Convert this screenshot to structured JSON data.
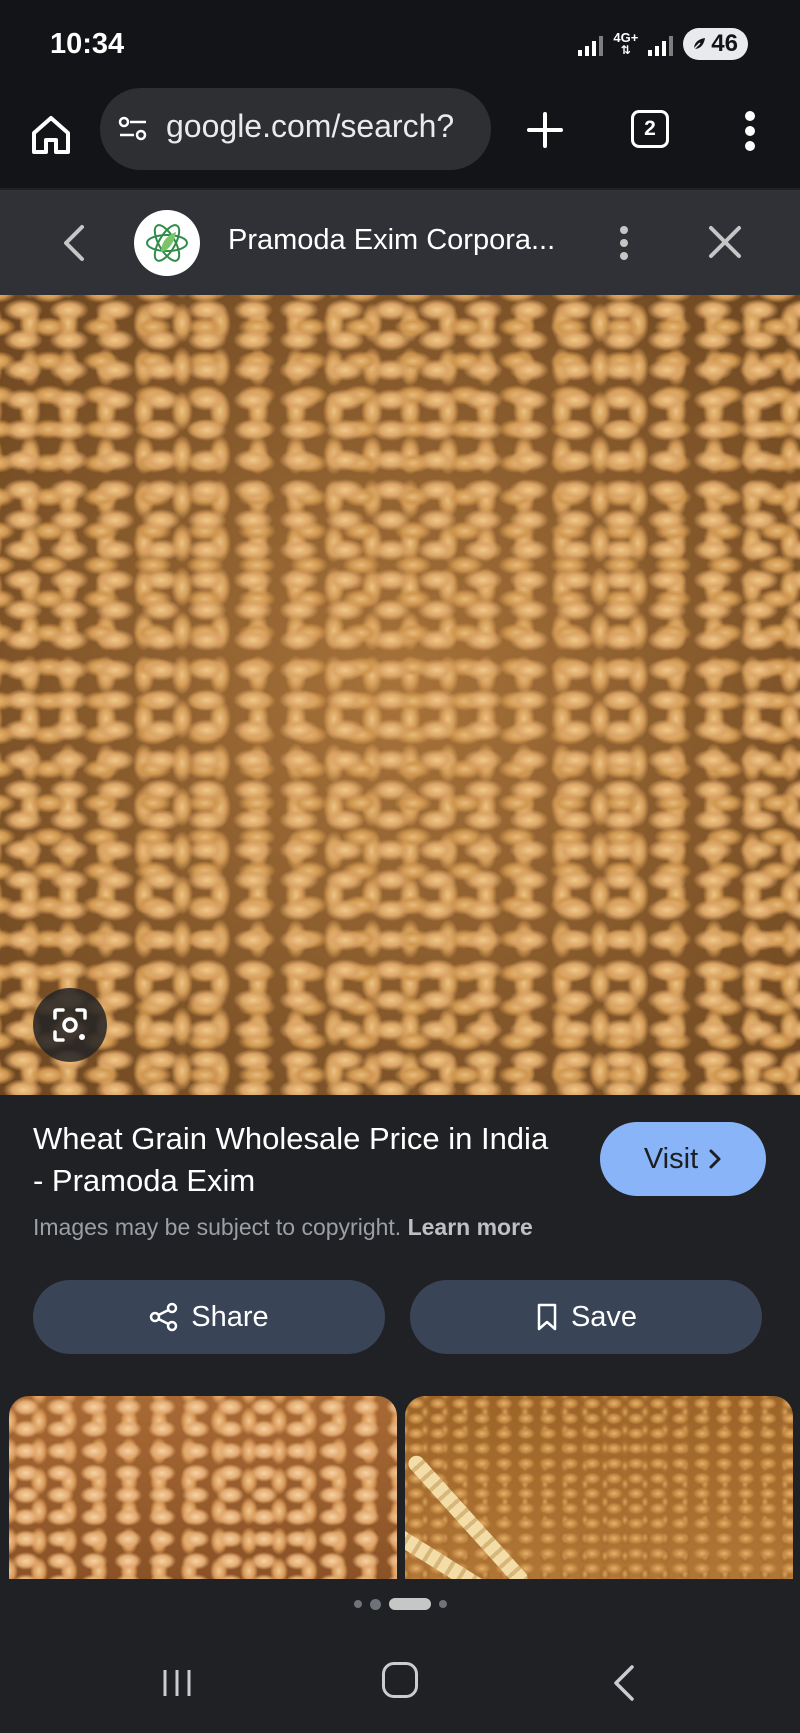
{
  "status_bar": {
    "time": "10:34",
    "network_label": "4G+",
    "battery_level": "46"
  },
  "browser": {
    "url": "google.com/search?",
    "tab_count": "2"
  },
  "source": {
    "site_name": "Pramoda Exim Corpora..."
  },
  "result": {
    "title": "Wheat Grain Wholesale Price in India - Pramoda Exim",
    "visit_label": "Visit",
    "copyright_text": "Images may be subject to copyright.",
    "learn_more_label": "Learn more",
    "share_label": "Share",
    "save_label": "Save"
  },
  "pager": {
    "pages": 4,
    "active_index": 2
  },
  "colors": {
    "background": "#202124",
    "accent": "#8ab4f8",
    "action_button": "#394457",
    "top_bar": "#131417"
  },
  "icons": [
    "home-icon",
    "site-settings-icon",
    "plus-icon",
    "tab-switcher-icon",
    "more-vert-icon",
    "chevron-left-icon",
    "close-icon",
    "lens-icon",
    "share-icon",
    "bookmark-icon",
    "chevron-right-icon",
    "recents-icon",
    "nav-home-icon",
    "nav-back-icon"
  ]
}
